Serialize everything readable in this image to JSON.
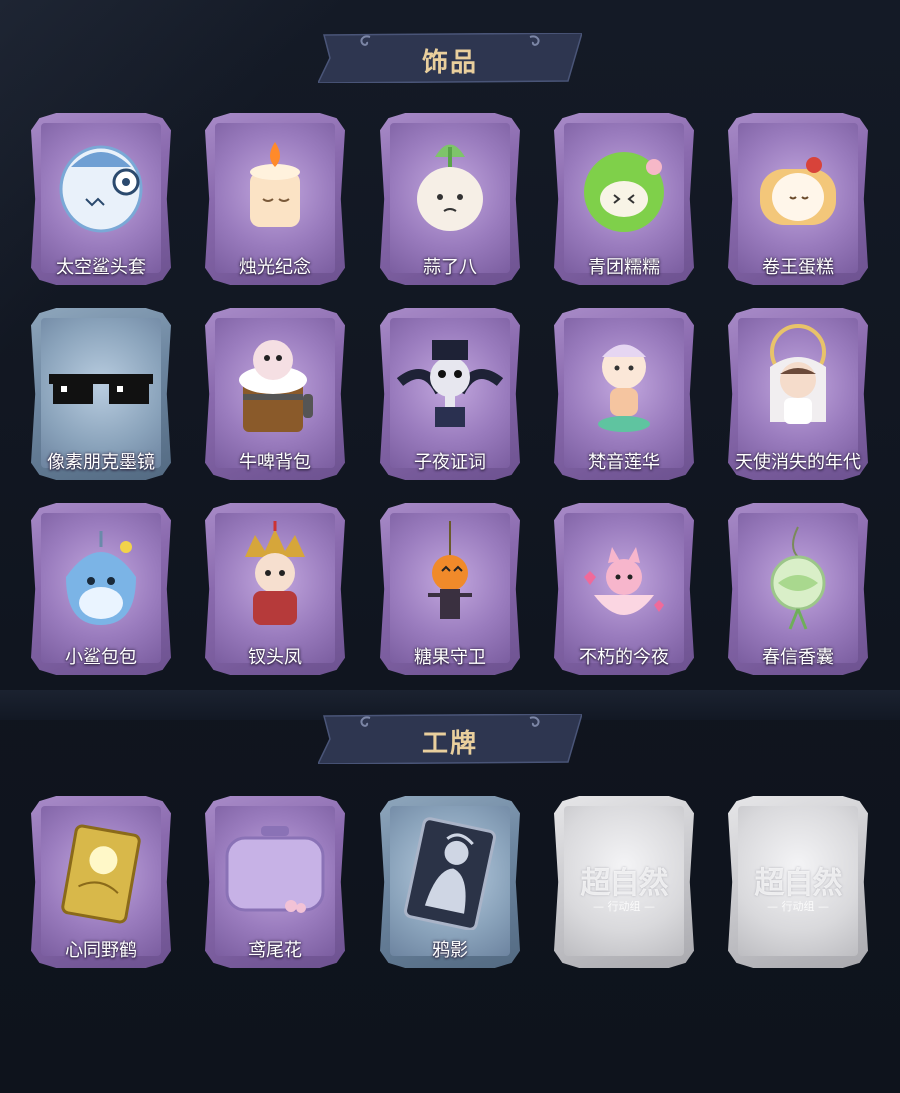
{
  "sections": [
    {
      "title": "饰品",
      "items": [
        {
          "label": "太空鲨头套",
          "icon": "space-shark-helmet-icon",
          "theme": "purple"
        },
        {
          "label": "烛光纪念",
          "icon": "candle-icon",
          "theme": "purple"
        },
        {
          "label": "蒜了八",
          "icon": "garlic-icon",
          "theme": "purple"
        },
        {
          "label": "青团糯糯",
          "icon": "green-rice-ball-icon",
          "theme": "purple"
        },
        {
          "label": "卷王蛋糕",
          "icon": "roll-cake-icon",
          "theme": "purple"
        },
        {
          "label": "像素朋克墨镜",
          "icon": "pixel-sunglasses-icon",
          "theme": "blue"
        },
        {
          "label": "牛啤背包",
          "icon": "cow-beer-backpack-icon",
          "theme": "purple"
        },
        {
          "label": "子夜证词",
          "icon": "plague-doctor-icon",
          "theme": "purple"
        },
        {
          "label": "梵音莲华",
          "icon": "lotus-figure-icon",
          "theme": "purple"
        },
        {
          "label": "天使消失的年代",
          "icon": "angel-doll-icon",
          "theme": "purple"
        },
        {
          "label": "小鲨包包",
          "icon": "shark-bag-icon",
          "theme": "purple"
        },
        {
          "label": "钗头凤",
          "icon": "phoenix-crown-doll-icon",
          "theme": "purple"
        },
        {
          "label": "糖果守卫",
          "icon": "pumpkin-guard-icon",
          "theme": "purple"
        },
        {
          "label": "不朽的今夜",
          "icon": "pink-fox-cup-icon",
          "theme": "purple"
        },
        {
          "label": "春信香囊",
          "icon": "green-sachet-icon",
          "theme": "purple"
        }
      ]
    },
    {
      "title": "工牌",
      "items": [
        {
          "label": "心同野鹤",
          "icon": "golden-card-icon",
          "theme": "purple"
        },
        {
          "label": "鸢尾花",
          "icon": "iris-badge-icon",
          "theme": "purple"
        },
        {
          "label": "鸦影",
          "icon": "silhouette-card-icon",
          "theme": "blue"
        },
        {
          "label": "",
          "icon": "supernatural-logo-placeholder",
          "theme": "gray",
          "logo": "超自然",
          "logo_sub": "— 行动组 —"
        },
        {
          "label": "",
          "icon": "supernatural-logo-placeholder",
          "theme": "gray",
          "logo": "超自然",
          "logo_sub": "— 行动组 —"
        }
      ]
    }
  ],
  "colors": {
    "background": "#111722",
    "header_banner": "#2e3650",
    "header_text": "#e9cf9d",
    "card_purple": "#8a6aae",
    "card_blue": "#6d86a0",
    "card_gray": "#c8c8cc"
  }
}
